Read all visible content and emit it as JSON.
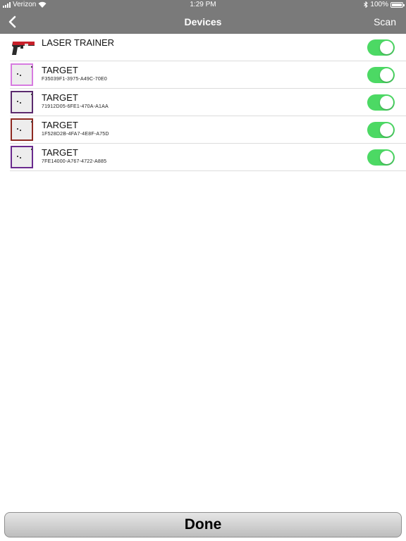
{
  "status_bar": {
    "carrier": "Verizon",
    "time": "1:29 PM",
    "battery": "100%"
  },
  "nav": {
    "title": "Devices",
    "scan_label": "Scan"
  },
  "devices": [
    {
      "name": "LASER TRAINER",
      "id": "",
      "icon": "laser-pistol-icon",
      "enabled": true
    },
    {
      "name": "TARGET",
      "id": "F35039F1-3975-A49C-70E0",
      "icon": "target-icon",
      "border_color": "#d77be0",
      "enabled": true
    },
    {
      "name": "TARGET",
      "id": "71912D05-6FE1-470A-A1AA",
      "icon": "target-icon",
      "border_color": "#5b2a6e",
      "enabled": true
    },
    {
      "name": "TARGET",
      "id": "1F528D2B-4FA7-4E8F-A75D",
      "icon": "target-icon",
      "border_color": "#8e2a22",
      "enabled": true
    },
    {
      "name": "TARGET",
      "id": "7FE14000-A767-4722-A885",
      "icon": "target-icon",
      "border_color": "#6a2a8e",
      "enabled": true
    }
  ],
  "toggle_color": "#4cd964",
  "done_label": "Done"
}
